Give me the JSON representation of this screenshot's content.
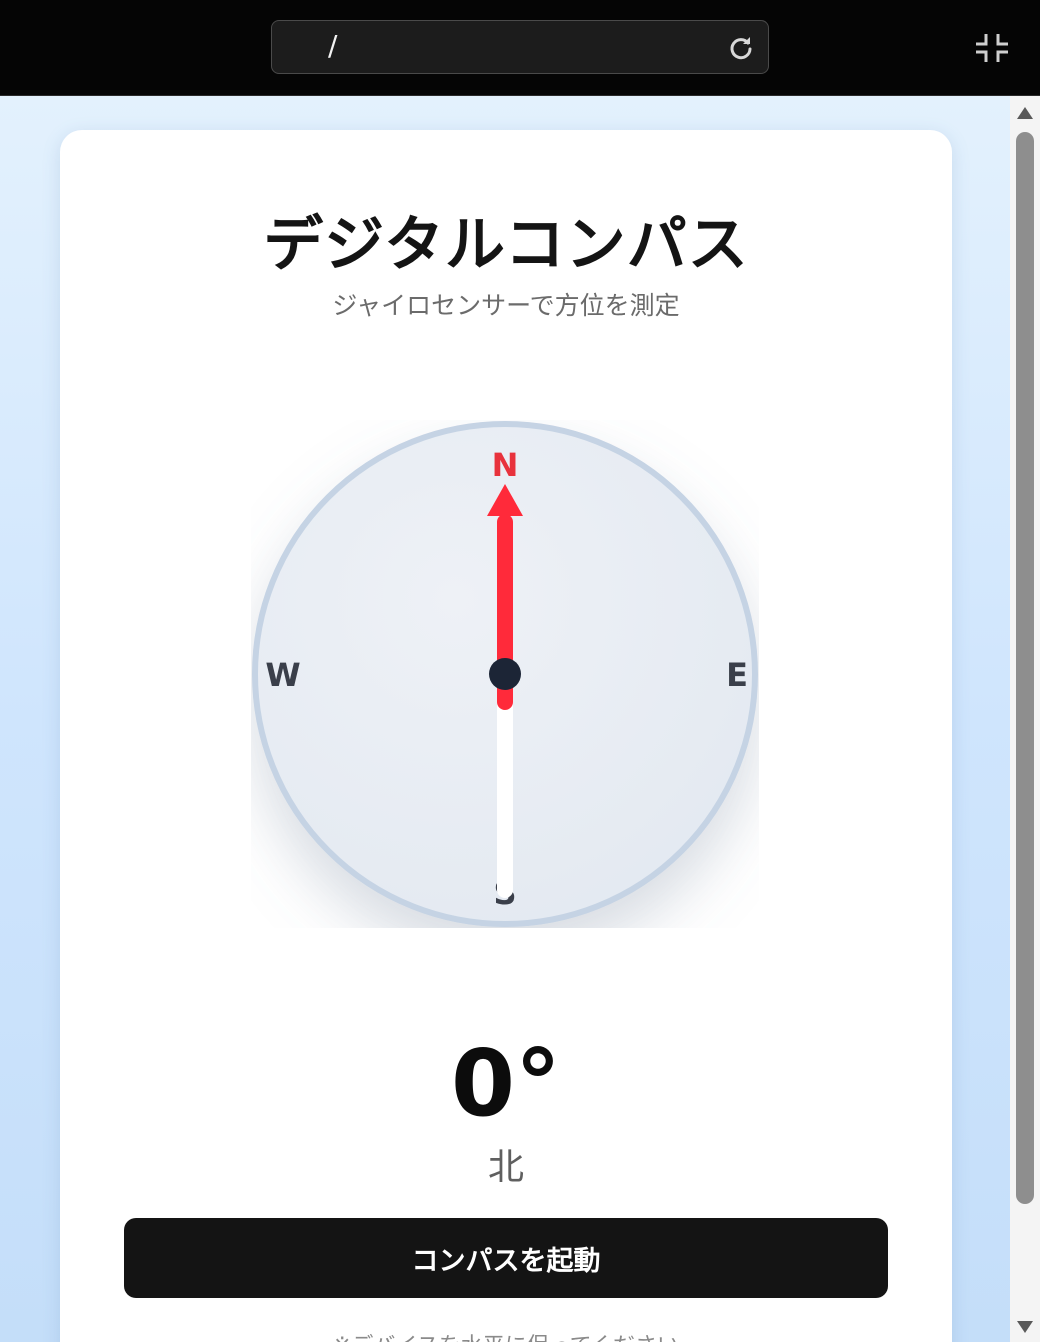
{
  "browser": {
    "url": "/",
    "icons": {
      "reload": "reload-icon",
      "exit_fullscreen": "exit-fullscreen-icon"
    }
  },
  "app": {
    "title": "デジタルコンパス",
    "subtitle": "ジャイロセンサーで方位を測定",
    "compass": {
      "north_label": "N",
      "east_label": "E",
      "south_label": "S",
      "west_label": "W",
      "needle_rotation_deg": 0,
      "colors": {
        "north_needle": "#ff2a3a",
        "south_needle": "#ffffff",
        "hub": "#1c2536",
        "north_text": "#e8323c",
        "cardinal_text": "#3a3f4a",
        "rim": "#c5d3e4"
      }
    },
    "heading_value": "0°",
    "direction_label": "北",
    "start_button_label": "コンパスを起動",
    "note": "※デバイスを水平に保ってください"
  }
}
